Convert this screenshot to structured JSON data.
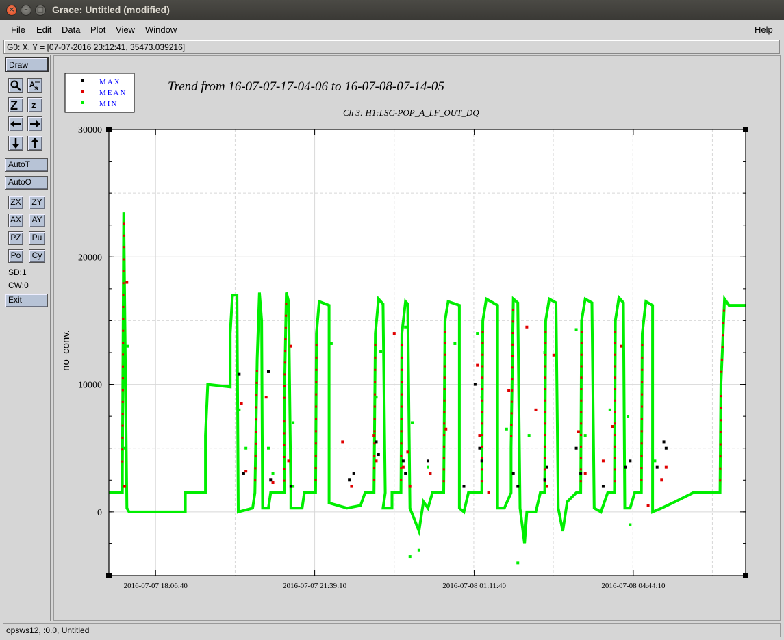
{
  "window": {
    "title": "Grace: Untitled (modified)"
  },
  "menubar": {
    "items": [
      {
        "label": "File",
        "u": "F",
        "rest": "ile"
      },
      {
        "label": "Edit",
        "u": "E",
        "rest": "dit"
      },
      {
        "label": "Data",
        "u": "D",
        "rest": "ata"
      },
      {
        "label": "Plot",
        "u": "P",
        "rest": "lot"
      },
      {
        "label": "View",
        "u": "V",
        "rest": "iew"
      },
      {
        "label": "Window",
        "u": "W",
        "rest": "indow"
      }
    ],
    "help": {
      "label": "Help",
      "u": "H",
      "rest": "elp"
    }
  },
  "locator": {
    "text": "G0: X, Y = [07-07-2016 23:12:41, 35473.039216]"
  },
  "toolbar": {
    "draw": "Draw",
    "autot": "AutoT",
    "autoo": "AutoO",
    "zx": "ZX",
    "zy": "ZY",
    "ax": "AX",
    "ay": "AY",
    "pz": "PZ",
    "pu": "Pu",
    "po": "Po",
    "cy": "Cy",
    "sd": "SD:1",
    "cw": "CW:0",
    "exit": "Exit",
    "icons": [
      "zoom-icon",
      "autoscale-text-icon",
      "zoom-z-icon",
      "shrink-z-icon",
      "left-arrow-icon",
      "right-arrow-icon",
      "down-arrow-icon",
      "up-arrow-icon"
    ]
  },
  "status": {
    "text": "opsws12, :0.0, Untitled"
  },
  "colors": {
    "max": "#000000",
    "mean": "#e00000",
    "min": "#00ee00",
    "legend_text": "#0000ff"
  },
  "chart_data": {
    "type": "scatter",
    "title": "Trend from 16-07-07-17-04-06 to 16-07-08-07-14-05",
    "subtitle": "Ch 3: H1:LSC-POP_A_LF_OUT_DQ",
    "ylabel": "no_conv.",
    "ylim": [
      -5000,
      30000
    ],
    "yticks": [
      "-5000",
      "0",
      "10000",
      "20000",
      "30000"
    ],
    "ytick_labels": [
      "0",
      "10000",
      "20000",
      "30000"
    ],
    "xlim_hours": [
      0,
      14.17
    ],
    "xtick_labels": [
      "2016-07-07 18:06:40",
      "2016-07-07 21:39:10",
      "2016-07-08 01:11:40",
      "2016-07-08 04:44:10"
    ],
    "xtick_hours": [
      1.04,
      4.58,
      8.13,
      11.67
    ],
    "grid": true,
    "legend": [
      "MAX",
      "MEAN",
      "MIN"
    ],
    "series": [
      {
        "name": "MIN",
        "segments": [
          [
            0.0,
            1500
          ],
          [
            0.3,
            1500
          ],
          [
            0.3,
            3000
          ],
          [
            0.33,
            23500
          ],
          [
            0.4,
            300
          ],
          [
            0.45,
            0
          ],
          [
            1.7,
            0
          ],
          [
            1.7,
            1500
          ],
          [
            2.15,
            1500
          ],
          [
            2.15,
            6000
          ],
          [
            2.2,
            10000
          ],
          [
            2.7,
            9800
          ],
          [
            2.7,
            14000
          ],
          [
            2.75,
            17000
          ],
          [
            2.85,
            17000
          ],
          [
            2.88,
            0
          ],
          [
            3.2,
            300
          ],
          [
            3.25,
            1500
          ],
          [
            3.3,
            12000
          ],
          [
            3.35,
            17200
          ],
          [
            3.4,
            15000
          ],
          [
            3.42,
            300
          ],
          [
            3.55,
            300
          ],
          [
            3.6,
            1500
          ],
          [
            3.9,
            1500
          ],
          [
            3.9,
            8000
          ],
          [
            3.95,
            17200
          ],
          [
            4.0,
            16500
          ],
          [
            4.05,
            1500
          ],
          [
            4.05,
            300
          ],
          [
            4.3,
            300
          ],
          [
            4.35,
            1500
          ],
          [
            4.6,
            1500
          ],
          [
            4.62,
            14000
          ],
          [
            4.68,
            16500
          ],
          [
            4.9,
            16200
          ],
          [
            4.9,
            700
          ],
          [
            5.3,
            300
          ],
          [
            5.6,
            500
          ],
          [
            5.7,
            1500
          ],
          [
            5.9,
            1500
          ],
          [
            5.93,
            14000
          ],
          [
            6.0,
            16700
          ],
          [
            6.1,
            16300
          ],
          [
            6.15,
            1500
          ],
          [
            6.1,
            300
          ],
          [
            6.3,
            300
          ],
          [
            6.3,
            1500
          ],
          [
            6.5,
            1500
          ],
          [
            6.52,
            14000
          ],
          [
            6.6,
            16500
          ],
          [
            6.65,
            16300
          ],
          [
            6.7,
            300
          ],
          [
            6.9,
            -1500
          ],
          [
            7.0,
            800
          ],
          [
            7.1,
            300
          ],
          [
            7.2,
            1500
          ],
          [
            7.45,
            1500
          ],
          [
            7.48,
            15000
          ],
          [
            7.55,
            16500
          ],
          [
            7.8,
            16200
          ],
          [
            7.8,
            300
          ],
          [
            7.9,
            0
          ],
          [
            8.0,
            1500
          ],
          [
            8.3,
            1500
          ],
          [
            8.32,
            15000
          ],
          [
            8.4,
            16700
          ],
          [
            8.65,
            16200
          ],
          [
            8.65,
            300
          ],
          [
            8.8,
            300
          ],
          [
            8.95,
            1500
          ],
          [
            8.95,
            5000
          ],
          [
            9.0,
            16700
          ],
          [
            9.1,
            16400
          ],
          [
            9.15,
            300
          ],
          [
            9.25,
            -2500
          ],
          [
            9.3,
            0
          ],
          [
            9.5,
            0
          ],
          [
            9.6,
            1500
          ],
          [
            9.7,
            1500
          ],
          [
            9.72,
            15000
          ],
          [
            9.8,
            16700
          ],
          [
            9.95,
            16400
          ],
          [
            10.0,
            300
          ],
          [
            10.1,
            -1500
          ],
          [
            10.2,
            800
          ],
          [
            10.4,
            1500
          ],
          [
            10.5,
            1500
          ],
          [
            10.52,
            15000
          ],
          [
            10.6,
            16700
          ],
          [
            10.75,
            16400
          ],
          [
            10.8,
            300
          ],
          [
            10.95,
            0
          ],
          [
            11.1,
            1500
          ],
          [
            11.25,
            1500
          ],
          [
            11.27,
            15000
          ],
          [
            11.35,
            16800
          ],
          [
            11.45,
            16400
          ],
          [
            11.48,
            300
          ],
          [
            11.6,
            300
          ],
          [
            11.7,
            1500
          ],
          [
            11.85,
            1500
          ],
          [
            11.87,
            14000
          ],
          [
            11.95,
            16500
          ],
          [
            12.1,
            16200
          ],
          [
            12.1,
            0
          ],
          [
            12.3,
            300
          ],
          [
            12.6,
            800
          ],
          [
            13.0,
            1500
          ],
          [
            13.2,
            1500
          ],
          [
            13.6,
            1500
          ],
          [
            13.62,
            10000
          ],
          [
            13.7,
            16700
          ],
          [
            13.8,
            16200
          ],
          [
            14.17,
            16200
          ]
        ]
      }
    ],
    "scatter_points": {
      "MAX": [
        [
          2.9,
          10800
        ],
        [
          3.0,
          3000
        ],
        [
          3.55,
          11000
        ],
        [
          3.6,
          2500
        ],
        [
          4.05,
          2000
        ],
        [
          5.35,
          2500
        ],
        [
          5.45,
          3000
        ],
        [
          5.95,
          5500
        ],
        [
          6.0,
          4500
        ],
        [
          6.55,
          4000
        ],
        [
          6.6,
          3000
        ],
        [
          7.1,
          4000
        ],
        [
          7.15,
          3000
        ],
        [
          7.9,
          2000
        ],
        [
          8.15,
          10000
        ],
        [
          8.25,
          5000
        ],
        [
          8.3,
          4000
        ],
        [
          9.0,
          3000
        ],
        [
          9.1,
          2000
        ],
        [
          9.7,
          2500
        ],
        [
          9.75,
          3500
        ],
        [
          10.4,
          5000
        ],
        [
          10.5,
          3000
        ],
        [
          11.0,
          2000
        ],
        [
          11.5,
          3500
        ],
        [
          11.6,
          4000
        ],
        [
          12.2,
          3500
        ],
        [
          12.35,
          5500
        ],
        [
          12.4,
          5000
        ]
      ],
      "MEAN": [
        [
          0.35,
          2000
        ],
        [
          0.4,
          18000
        ],
        [
          2.95,
          8500
        ],
        [
          3.05,
          3200
        ],
        [
          3.5,
          9000
        ],
        [
          3.65,
          2300
        ],
        [
          4.0,
          4000
        ],
        [
          4.05,
          13000
        ],
        [
          5.2,
          5500
        ],
        [
          5.4,
          2000
        ],
        [
          5.9,
          6000
        ],
        [
          5.95,
          4000
        ],
        [
          6.35,
          14000
        ],
        [
          6.55,
          3500
        ],
        [
          6.65,
          4700
        ],
        [
          6.7,
          2000
        ],
        [
          7.15,
          3000
        ],
        [
          7.5,
          6500
        ],
        [
          8.2,
          11500
        ],
        [
          8.25,
          6000
        ],
        [
          8.45,
          1500
        ],
        [
          8.9,
          9500
        ],
        [
          9.3,
          14500
        ],
        [
          9.5,
          8000
        ],
        [
          9.9,
          12300
        ],
        [
          9.75,
          2000
        ],
        [
          10.45,
          6300
        ],
        [
          10.6,
          3000
        ],
        [
          11.0,
          4000
        ],
        [
          11.2,
          6700
        ],
        [
          11.4,
          13000
        ],
        [
          12.0,
          500
        ],
        [
          12.3,
          2500
        ],
        [
          12.4,
          3500
        ]
      ],
      "MIN": [
        [
          0.35,
          5000
        ],
        [
          0.42,
          13000
        ],
        [
          2.9,
          8000
        ],
        [
          3.05,
          5000
        ],
        [
          3.55,
          5000
        ],
        [
          3.65,
          3000
        ],
        [
          4.1,
          7000
        ],
        [
          4.1,
          2000
        ],
        [
          4.95,
          13200
        ],
        [
          5.95,
          9000
        ],
        [
          6.05,
          12600
        ],
        [
          6.6,
          14500
        ],
        [
          6.75,
          7000
        ],
        [
          7.1,
          3500
        ],
        [
          7.7,
          13200
        ],
        [
          8.2,
          14000
        ],
        [
          8.3,
          9000
        ],
        [
          8.85,
          6500
        ],
        [
          9.35,
          6000
        ],
        [
          9.7,
          12500
        ],
        [
          10.4,
          14300
        ],
        [
          10.6,
          6000
        ],
        [
          11.15,
          8000
        ],
        [
          11.55,
          7500
        ],
        [
          11.6,
          -1000
        ],
        [
          12.15,
          4000
        ],
        [
          6.7,
          -3500
        ],
        [
          6.9,
          -3000
        ],
        [
          9.1,
          -4000
        ]
      ]
    }
  }
}
